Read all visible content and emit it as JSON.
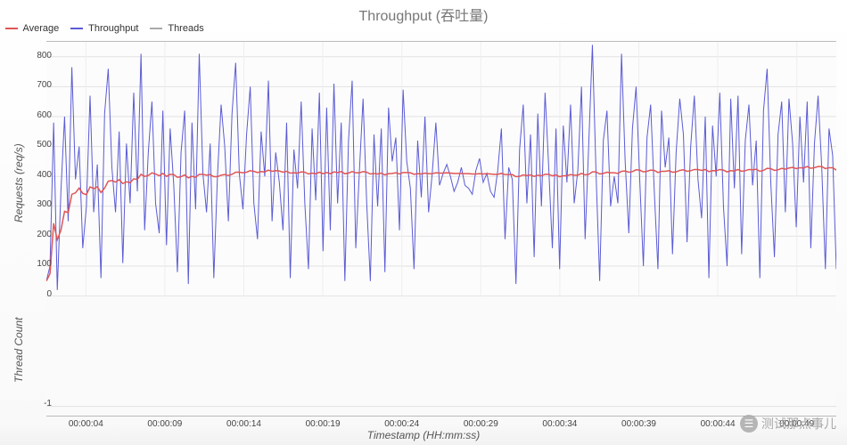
{
  "chart_data": {
    "type": "line",
    "title": "Throughput (吞吐量)",
    "xlabel": "Timestamp (HH:mm:ss)",
    "panels": [
      {
        "ylabel": "Requests (req/s)",
        "ylim": [
          0,
          850
        ],
        "yticks": [
          0,
          100,
          200,
          300,
          400,
          500,
          600,
          700,
          800
        ],
        "series": [
          {
            "name": "Throughput",
            "color": "#5b5bd6",
            "values": [
              50,
              100,
              580,
              20,
              350,
              600,
              250,
              765,
              390,
              500,
              160,
              300,
              670,
              280,
              440,
              60,
              610,
              760,
              430,
              280,
              550,
              110,
              510,
              310,
              680,
              350,
              810,
              220,
              480,
              650,
              310,
              210,
              620,
              170,
              560,
              370,
              80,
              480,
              620,
              40,
              580,
              290,
              810,
              410,
              280,
              510,
              60,
              400,
              640,
              500,
              250,
              610,
              780,
              410,
              290,
              540,
              700,
              310,
              190,
              550,
              400,
              720,
              250,
              480,
              380,
              220,
              580,
              60,
              490,
              360,
              650,
              310,
              90,
              560,
              320,
              680,
              150,
              630,
              220,
              710,
              310,
              580,
              50,
              520,
              720,
              160,
              420,
              660,
              310,
              50,
              540,
              300,
              560,
              80,
              630,
              450,
              530,
              220,
              690,
              450,
              360,
              90,
              520,
              330,
              600,
              280,
              410,
              580,
              370,
              410,
              440,
              400,
              350,
              380,
              430,
              370,
              360,
              340,
              420,
              460,
              380,
              410,
              350,
              330,
              420,
              560,
              190,
              430,
              390,
              40,
              490,
              640,
              310,
              540,
              130,
              610,
              300,
              680,
              430,
              160,
              560,
              90,
              570,
              380,
              640,
              310,
              420,
              700,
              190,
              510,
              840,
              410,
              50,
              520,
              620,
              300,
              400,
              310,
              810,
              450,
              210,
              560,
              700,
              390,
              100,
              530,
              640,
              350,
              90,
              620,
              430,
              530,
              140,
              480,
              660,
              540,
              180,
              500,
              670,
              390,
              260,
              600,
              60,
              570,
              400,
              680,
              300,
              100,
              660,
              360,
              670,
              140,
              520,
              640,
              370,
              520,
              60,
              620,
              760,
              380,
              130,
              540,
              650,
              280,
              660,
              510,
              230,
              600,
              380,
              650,
              160,
              510,
              670,
              430,
              90,
              560,
              470,
              90
            ]
          },
          {
            "name": "Average",
            "color": "#e05555",
            "values": [
              50,
              75,
              243,
              188,
              220,
              283,
              279,
              340,
              345,
              361,
              343,
              339,
              365,
              359,
              365,
              346,
              361,
              384,
              386,
              381,
              389,
              376,
              382,
              379,
              392,
              390,
              407,
              400,
              403,
              412,
              408,
              402,
              410,
              400,
              407,
              406,
              397,
              399,
              405,
              395,
              400,
              397,
              407,
              407,
              404,
              406,
              399,
              399,
              404,
              406,
              403,
              407,
              414,
              414,
              412,
              414,
              419,
              417,
              413,
              416,
              415,
              421,
              417,
              419,
              418,
              414,
              417,
              411,
              412,
              411,
              415,
              414,
              408,
              411,
              409,
              414,
              409,
              413,
              409,
              415,
              413,
              416,
              409,
              411,
              416,
              412,
              412,
              416,
              414,
              408,
              410,
              408,
              411,
              405,
              409,
              410,
              412,
              408,
              413,
              413,
              412,
              407,
              409,
              408,
              411,
              409,
              409,
              412,
              411,
              411,
              412,
              411,
              410,
              410,
              410,
              409,
              409,
              408,
              408,
              409,
              408,
              409,
              408,
              407,
              407,
              410,
              406,
              406,
              406,
              399,
              400,
              405,
              403,
              405,
              400,
              404,
              402,
              407,
              407,
              402,
              405,
              399,
              402,
              402,
              406,
              404,
              404,
              410,
              405,
              407,
              415,
              415,
              408,
              410,
              414,
              412,
              412,
              410,
              417,
              418,
              414,
              416,
              422,
              421,
              415,
              417,
              421,
              420,
              413,
              417,
              417,
              419,
              414,
              415,
              420,
              422,
              417,
              419,
              423,
              423,
              420,
              423,
              416,
              419,
              419,
              423,
              421,
              415,
              419,
              418,
              423,
              417,
              419,
              423,
              422,
              424,
              417,
              420,
              427,
              426,
              420,
              422,
              427,
              424,
              428,
              430,
              426,
              429,
              428,
              433,
              427,
              429,
              433,
              433,
              426,
              429,
              429,
              421
            ]
          }
        ]
      },
      {
        "ylabel": "Thread Count",
        "ylim": [
          -1,
          0
        ],
        "yticks": [
          -1
        ],
        "series": [
          {
            "name": "Threads",
            "color": "#aaaaaa",
            "values": []
          }
        ]
      }
    ],
    "x_categories": [
      "00:00:04",
      "00:00:09",
      "00:00:14",
      "00:00:19",
      "00:00:24",
      "00:00:29",
      "00:00:34",
      "00:00:39",
      "00:00:44",
      "00:00:49"
    ],
    "legend": [
      {
        "label": "Average",
        "color": "#e05555"
      },
      {
        "label": "Throughput",
        "color": "#5b5bd6"
      },
      {
        "label": "Threads",
        "color": "#aaaaaa"
      }
    ]
  },
  "watermark": "测试那点事儿"
}
